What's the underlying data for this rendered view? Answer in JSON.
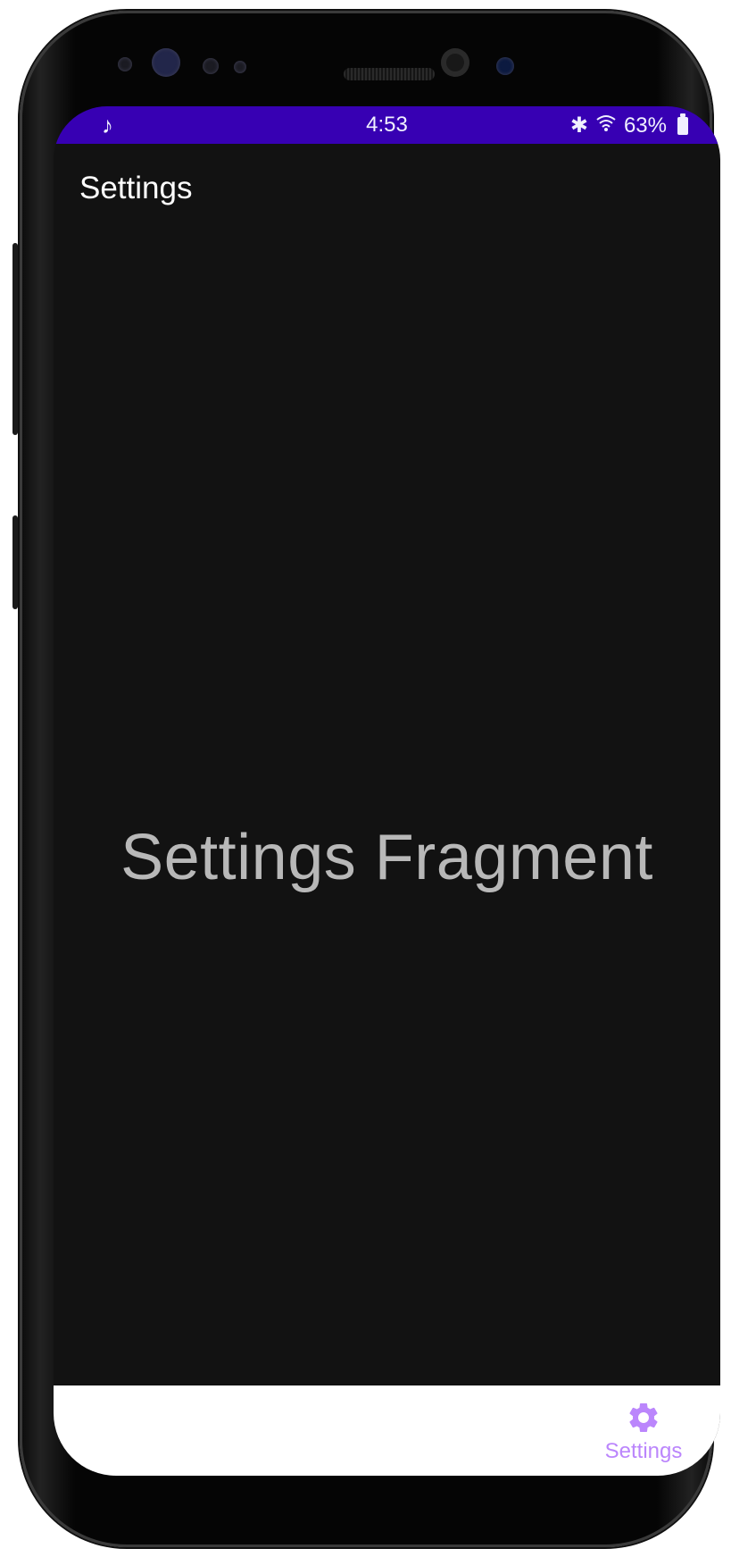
{
  "status_bar": {
    "left_icon": "music-note-icon",
    "left_glyph": "♪",
    "time": "4:53",
    "battery_percent": "63%",
    "bluetooth_glyph": "✱",
    "wifi_glyph": "≋"
  },
  "app_bar": {
    "title": "Settings"
  },
  "content": {
    "message": "Settings Fragment"
  },
  "bottom_nav": {
    "items": [
      {
        "label": "Settings",
        "icon": "gear-icon",
        "selected": true
      }
    ]
  },
  "colors": {
    "status_bar": "#3700b3",
    "background": "#121212",
    "accent": "#bb86fc",
    "nav_background": "#ffffff"
  }
}
